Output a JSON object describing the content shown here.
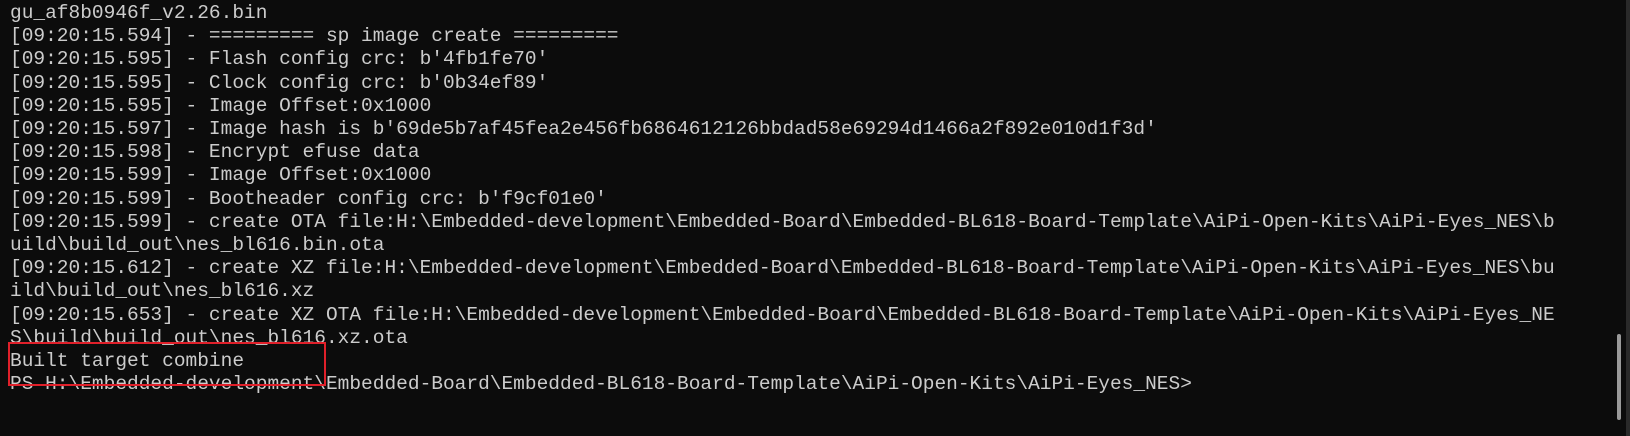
{
  "terminal": {
    "lines": [
      "gu_af8b0946f_v2.26.bin",
      "[09:20:15.594] - ========= sp image create =========",
      "[09:20:15.595] - Flash config crc: b'4fb1fe70'",
      "[09:20:15.595] - Clock config crc: b'0b34ef89'",
      "[09:20:15.595] - Image Offset:0x1000",
      "[09:20:15.597] - Image hash is b'69de5b7af45fea2e456fb6864612126bbdad58e69294d1466a2f892e010d1f3d'",
      "[09:20:15.598] - Encrypt efuse data",
      "[09:20:15.599] - Image Offset:0x1000",
      "[09:20:15.599] - Bootheader config crc: b'f9cf01e0'",
      "[09:20:15.599] - create OTA file:H:\\Embedded-development\\Embedded-Board\\Embedded-BL618-Board-Template\\AiPi-Open-Kits\\AiPi-Eyes_NES\\b",
      "uild\\build_out\\nes_bl616.bin.ota",
      "[09:20:15.612] - create XZ file:H:\\Embedded-development\\Embedded-Board\\Embedded-BL618-Board-Template\\AiPi-Open-Kits\\AiPi-Eyes_NES\\bu",
      "ild\\build_out\\nes_bl616.xz",
      "[09:20:15.653] - create XZ OTA file:H:\\Embedded-development\\Embedded-Board\\Embedded-BL618-Board-Template\\AiPi-Open-Kits\\AiPi-Eyes_NE",
      "S\\build\\build_out\\nes_bl616.xz.ota",
      "Built target combine",
      "PS H:\\Embedded-development\\Embedded-Board\\Embedded-BL618-Board-Template\\AiPi-Open-Kits\\AiPi-Eyes_NES>"
    ]
  },
  "colors": {
    "background": "#0c0c0c",
    "text": "#cccccc",
    "highlight_box": "#e0202a"
  }
}
